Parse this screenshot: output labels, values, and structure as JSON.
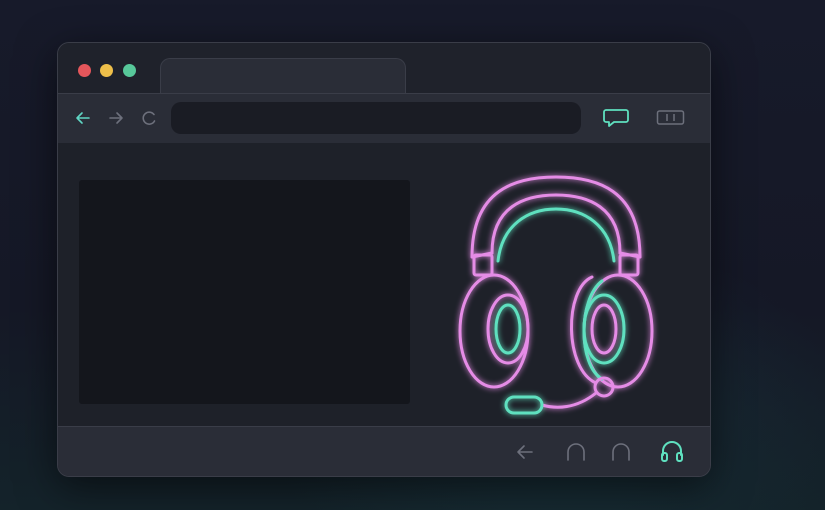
{
  "window": {
    "traffic_lights": [
      "close",
      "minimize",
      "maximize"
    ],
    "tab": {
      "label": ""
    }
  },
  "toolbar": {
    "back_icon": "arrow-left-icon",
    "forward_icon": "arrow-right-icon",
    "reload_icon": "reload-icon",
    "address": {
      "value": "",
      "placeholder": ""
    },
    "right_icons": [
      "chat-bubble-icon",
      "sidebar-toggle-icon"
    ]
  },
  "content": {
    "hero_icon": "headset-icon"
  },
  "bottombar": {
    "icons": [
      "arrow-left-icon",
      "headphones-outline-icon",
      "headphones-outline-icon",
      "headset-icon"
    ]
  },
  "colors": {
    "neon_pink": "#e58ce6",
    "neon_teal": "#5fe0bf",
    "window_bg": "#22252f",
    "panel_bg": "#14161c",
    "icon_muted": "#6d707c"
  }
}
